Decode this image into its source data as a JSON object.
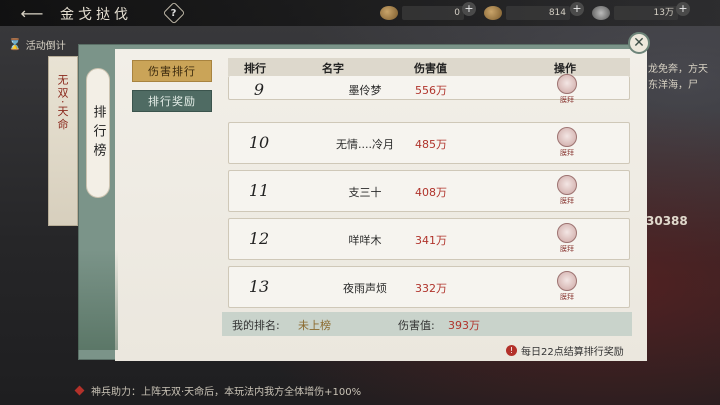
{
  "header": {
    "title": "金戈挞伐",
    "resources": [
      {
        "icon": "leaf-currency-icon",
        "value": "0"
      },
      {
        "icon": "ingot-currency-icon",
        "value": "814"
      },
      {
        "icon": "coin-currency-icon",
        "value": "13万"
      }
    ]
  },
  "activity": {
    "label": "活动倒计"
  },
  "left_banner": {
    "text": "无双·天命"
  },
  "side_tab": {
    "label": "排行榜"
  },
  "tabs": [
    {
      "label": "伤害排行",
      "active": true
    },
    {
      "label": "排行奖励",
      "active": false
    }
  ],
  "table": {
    "columns": [
      "排行",
      "名字",
      "伤害值",
      "操作"
    ],
    "action_label": "膜拜",
    "rows": [
      {
        "rank": "9",
        "name": "墨伶梦",
        "damage": "556万"
      },
      {
        "rank": "10",
        "name": "无情....冷月",
        "damage": "485万"
      },
      {
        "rank": "11",
        "name": "支三十",
        "damage": "408万"
      },
      {
        "rank": "12",
        "name": "咩咩木",
        "damage": "341万"
      },
      {
        "rank": "13",
        "name": "夜雨声烦",
        "damage": "332万"
      }
    ]
  },
  "my_rank": {
    "rank_label": "我的排名:",
    "rank_value": "未上榜",
    "damage_label": "伤害值:",
    "damage_value": "393万"
  },
  "notice": "每日22点结算排行奖励",
  "bottom_info": "神兵助力：上阵无双·天命后，本玩法内我方全体增伤+100%",
  "right_side": {
    "text_lines": [
      "龙免奔，方天",
      "东洋海，尸"
    ],
    "number": "30388"
  },
  "colors": {
    "accent_gold": "#caa458",
    "panel_green": "#7b9489",
    "damage_red": "#b0332b"
  }
}
